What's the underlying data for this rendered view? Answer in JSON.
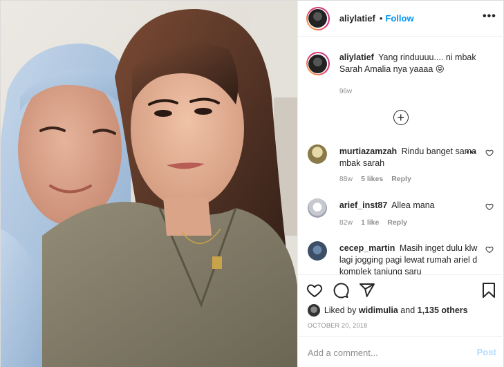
{
  "header": {
    "username": "aliylatief",
    "separator": "•",
    "follow_label": "Follow",
    "more_label": "•••"
  },
  "caption": {
    "username": "aliylatief",
    "text": "Yang rinduuuu.... ni mbak Sarah Amalia nya yaaaa 😝",
    "time": "96w"
  },
  "load_more": {
    "label": "+"
  },
  "comments": [
    {
      "username": "murtiazamzah",
      "text": "Rindu banget sama mbak sarah",
      "time": "88w",
      "likes": "5 likes",
      "reply": "Reply"
    },
    {
      "username": "arief_inst87",
      "text": "Allea mana",
      "time": "82w",
      "likes": "1 like",
      "reply": "Reply"
    },
    {
      "username": "cecep_martin",
      "text": "Masih inget dulu klw lagi jogging pagi lewat rumah ariel d komplek tanjung saru"
    }
  ],
  "likes": {
    "prefix": "Liked by",
    "user": "widimulia",
    "conjunction": "and",
    "others": "1,135 others"
  },
  "date": "OCTOBER 20, 2018",
  "add_comment": {
    "placeholder": "Add a comment...",
    "post_label": "Post"
  },
  "colors": {
    "link_blue": "#0095f6",
    "post_disabled": "#b3dbff",
    "muted": "#8e8e8e",
    "hijab": "#a9c3de",
    "shirt": "#7e7865"
  },
  "icons": [
    "heart-icon",
    "comment-icon",
    "share-icon",
    "bookmark-icon",
    "more-icon",
    "plus-circle-icon"
  ]
}
